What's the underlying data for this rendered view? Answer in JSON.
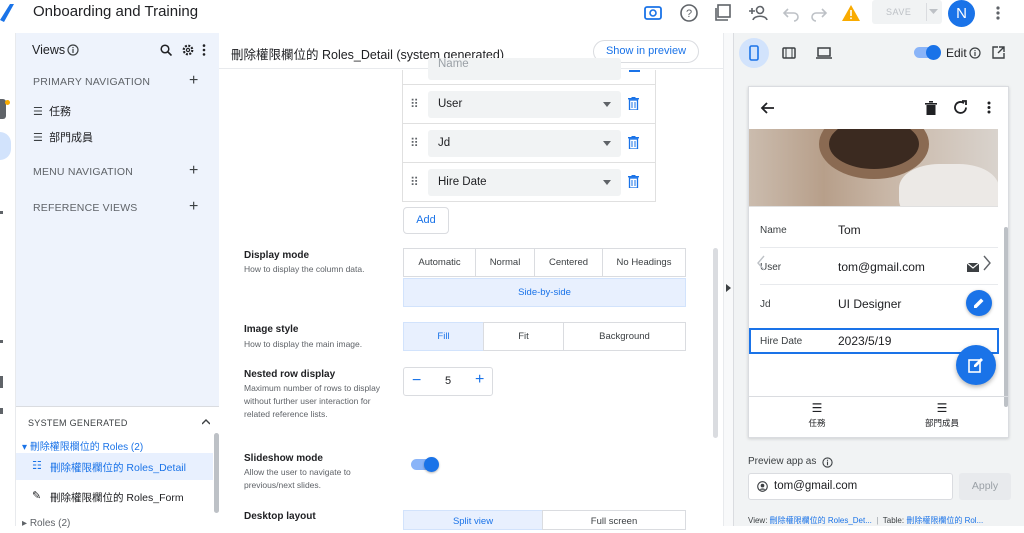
{
  "app": {
    "title": "Onboarding and Training",
    "save_label": "SAVE",
    "avatar_letter": "N"
  },
  "views_panel": {
    "title": "Views",
    "primary_nav_title": "PRIMARY NAVIGATION",
    "primary_items": [
      {
        "label": "任務"
      },
      {
        "label": "部門成員"
      }
    ],
    "menu_nav_title": "MENU NAVIGATION",
    "reference_views_title": "REFERENCE VIEWS",
    "system_generated_title": "SYSTEM GENERATED",
    "group_label": "刪除權限欄位的 Roles (2)",
    "sys_items": [
      {
        "label": "刪除權限欄位的 Roles_Detail"
      },
      {
        "label": "刪除權限欄位的 Roles_Form"
      }
    ],
    "roles_label": "Roles (2)"
  },
  "editor": {
    "view_title": "刪除權限欄位的 Roles_Detail (system generated)",
    "show_preview_label": "Show in preview",
    "column_fields": [
      {
        "value": "User"
      },
      {
        "value": "Jd"
      },
      {
        "value": "Hire Date"
      }
    ],
    "top_field_partial": "Name",
    "add_label": "Add",
    "display_mode": {
      "title": "Display mode",
      "desc": "How to display the column data.",
      "options": [
        "Automatic",
        "Normal",
        "Centered",
        "No Headings"
      ],
      "selected": "Side-by-side"
    },
    "image_style": {
      "title": "Image style",
      "desc": "How to display the main image.",
      "options": [
        "Fill",
        "Fit",
        "Background"
      ],
      "selected": "Fill"
    },
    "nested_row_display": {
      "title": "Nested row display",
      "desc": "Maximum number of rows to display without further user interaction for related reference lists.",
      "value": "5"
    },
    "slideshow_mode": {
      "title": "Slideshow mode",
      "desc": "Allow the user to navigate to previous/next slides.",
      "enabled": true
    },
    "desktop_layout": {
      "title": "Desktop layout",
      "options": [
        "Split view",
        "Full screen"
      ],
      "selected": "Split view"
    }
  },
  "preview": {
    "edit_label": "Edit",
    "rows": [
      {
        "label": "Name",
        "value": "Tom"
      },
      {
        "label": "User",
        "value": "tom@gmail.com"
      },
      {
        "label": "Jd",
        "value": "UI Designer"
      },
      {
        "label": "Hire Date",
        "value": "2023/5/19"
      }
    ],
    "bottom_nav": [
      {
        "label": "任務"
      },
      {
        "label": "部門成員"
      }
    ],
    "preview_as_label": "Preview app as",
    "preview_as_value": "tom@gmail.com",
    "apply_label": "Apply",
    "footer_view_label": "View:",
    "footer_view_link": "刪除權限欄位的 Roles_Det...",
    "footer_table_label": "Table:",
    "footer_table_link": "刪除權限欄位的 Rol..."
  },
  "colors": {
    "accent": "#1a73e8",
    "warning": "#f9ab00",
    "panel_bg": "#eef3fc"
  }
}
